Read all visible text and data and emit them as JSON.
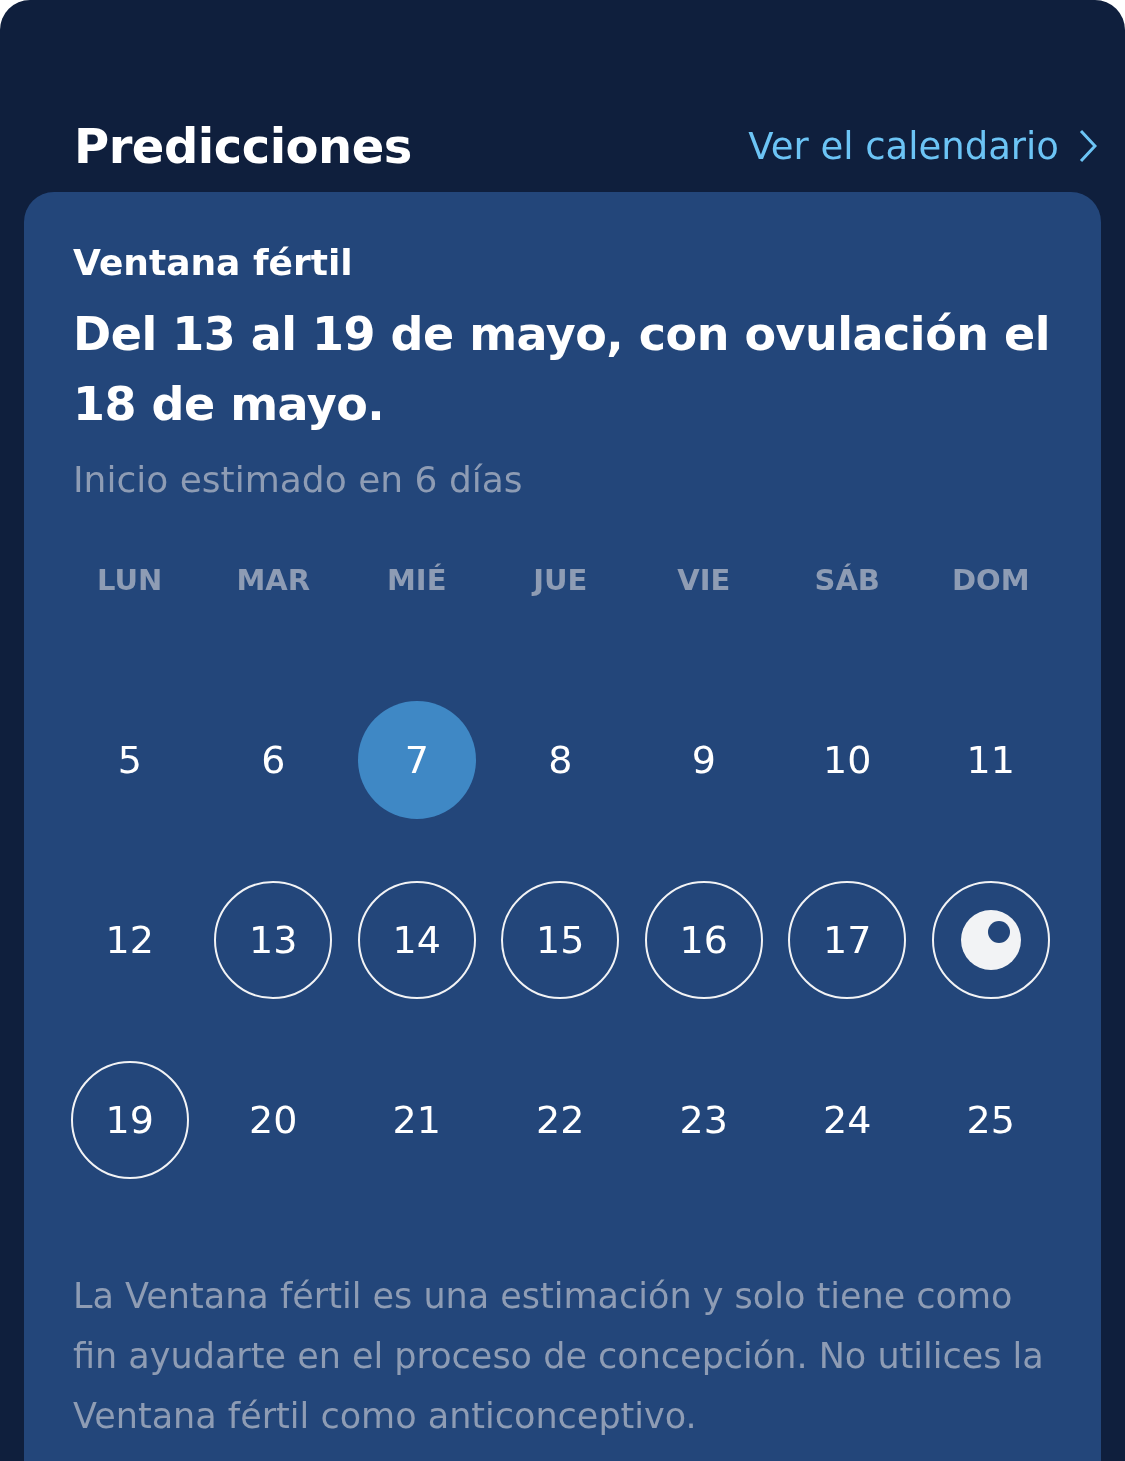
{
  "header": {
    "title": "Predicciones",
    "link": "Ver el calendario"
  },
  "card": {
    "label": "Ventana fértil",
    "headline": "Del 13 al 19 de mayo, con ovulación el 18 de mayo.",
    "subtitle": "Inicio estimado en 6 días",
    "weekdays": [
      "LUN",
      "MAR",
      "MIÉ",
      "JUE",
      "VIE",
      "SÁB",
      "DOM"
    ],
    "days": [
      {
        "label": "5",
        "kind": "plain"
      },
      {
        "label": "6",
        "kind": "plain"
      },
      {
        "label": "7",
        "kind": "today"
      },
      {
        "label": "8",
        "kind": "plain"
      },
      {
        "label": "9",
        "kind": "plain"
      },
      {
        "label": "10",
        "kind": "plain"
      },
      {
        "label": "11",
        "kind": "plain"
      },
      {
        "label": "12",
        "kind": "plain"
      },
      {
        "label": "13",
        "kind": "fertile"
      },
      {
        "label": "14",
        "kind": "fertile"
      },
      {
        "label": "15",
        "kind": "fertile"
      },
      {
        "label": "16",
        "kind": "fertile"
      },
      {
        "label": "17",
        "kind": "fertile"
      },
      {
        "kind": "ovulation"
      },
      {
        "label": "19",
        "kind": "fertile"
      },
      {
        "label": "20",
        "kind": "plain"
      },
      {
        "label": "21",
        "kind": "plain"
      },
      {
        "label": "22",
        "kind": "plain"
      },
      {
        "label": "23",
        "kind": "plain"
      },
      {
        "label": "24",
        "kind": "plain"
      },
      {
        "label": "25",
        "kind": "plain"
      }
    ],
    "note": "La Ventana fértil es una estimación y solo tiene como fin ayudarte en el proceso de concepción. No utilices la Ventana fértil como anticonceptivo."
  }
}
